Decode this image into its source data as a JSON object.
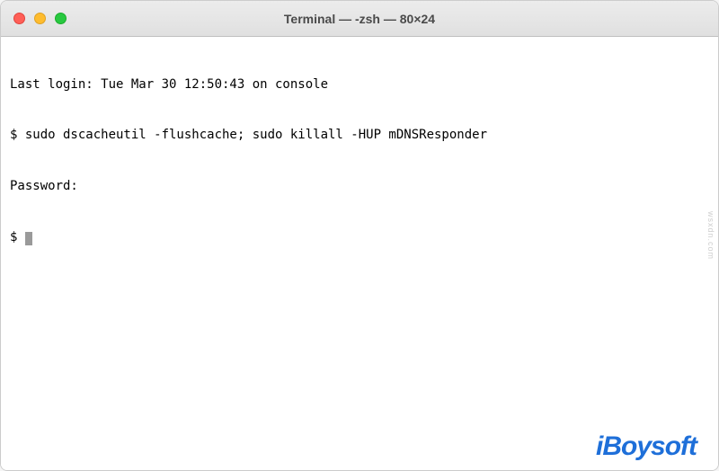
{
  "window": {
    "title": "Terminal — -zsh — 80×24"
  },
  "terminal": {
    "lines": {
      "last_login": "Last login: Tue Mar 30 12:50:43 on console",
      "command_line": "$ sudo dscacheutil -flushcache; sudo killall -HUP mDNSResponder",
      "password_prompt": "Password:",
      "prompt": "$ "
    }
  },
  "watermark": {
    "text": "iBoysoft"
  },
  "side": {
    "text": "wsxdn.com"
  }
}
